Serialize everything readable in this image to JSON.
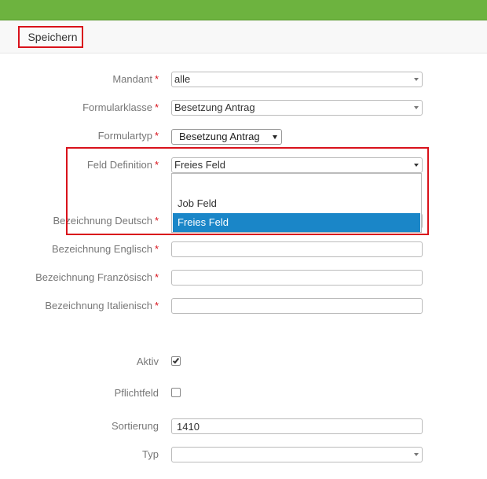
{
  "toolbar": {
    "save_label": "Speichern"
  },
  "form": {
    "mandant": {
      "label": "Mandant",
      "value": "alle"
    },
    "formularklasse": {
      "label": "Formularklasse",
      "value": "Besetzung Antrag"
    },
    "formulartyp": {
      "label": "Formulartyp",
      "value": "Besetzung Antrag"
    },
    "feld_definition": {
      "label": "Feld Definition",
      "value": "Freies Feld",
      "options": [
        "",
        "Job Feld",
        "Freies Feld"
      ],
      "open": true
    },
    "bez_deutsch": {
      "label": "Bezeichnung Deutsch",
      "value": ""
    },
    "bez_englisch": {
      "label": "Bezeichnung Englisch",
      "value": ""
    },
    "bez_franz": {
      "label": "Bezeichnung Französisch",
      "value": ""
    },
    "bez_ital": {
      "label": "Bezeichnung Italienisch",
      "value": ""
    },
    "aktiv": {
      "label": "Aktiv",
      "checked": true
    },
    "pflichtfeld": {
      "label": "Pflichtfeld",
      "checked": false
    },
    "sortierung": {
      "label": "Sortierung",
      "value": "1410"
    },
    "typ": {
      "label": "Typ",
      "value": ""
    },
    "required_marker": "*"
  },
  "colors": {
    "topbar": "#6db33f",
    "required": "#d9121b",
    "selected_option": "#1a86c8",
    "highlight": "#d9121b"
  }
}
